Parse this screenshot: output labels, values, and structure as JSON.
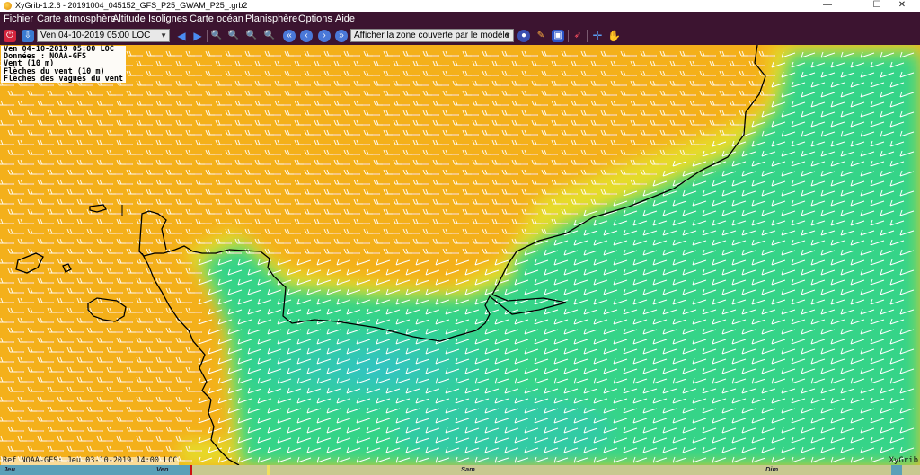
{
  "window": {
    "title": "XyGrib-1.2.6 - 20191004_045152_GFS_P25_GWAM_P25_.grb2",
    "minimize_glyph": "—",
    "maximize_glyph": "☐",
    "close_glyph": "✕"
  },
  "menubar": {
    "items": [
      "Fichier",
      "Carte atmosphère",
      "Altitude",
      "Isolignes",
      "Carte océan",
      "Planisphère",
      "Options",
      "Aide"
    ]
  },
  "toolbar": {
    "date_combo": "Ven 04-10-2019 05:00 LOC",
    "zone_combo": "Afficher la zone couverte par le modèle",
    "icons": [
      "app-icon",
      "download-icon",
      "prev-icon",
      "next-icon",
      "zoom-in-icon",
      "zoom-out-icon",
      "zoom-fit-icon",
      "zoom-all-icon",
      "time-back-fast-icon",
      "time-back-icon",
      "time-forward-icon",
      "time-forward-fast-icon",
      "globe-icon",
      "palette-icon",
      "meteogram-icon",
      "rocket-icon",
      "crosshair-icon",
      "hand-icon"
    ]
  },
  "legend": {
    "line1": "Ven 04-10-2019 05:00 LOC",
    "line2": "Données : NOAA-GFS",
    "line3": "Vent (10 m)",
    "line4": "Flèches du vent (10 m)",
    "line5": "Flèches des vagues du vent"
  },
  "footer": {
    "ref": "Ref NOAA-GFS: Jeu 03-10-2019 14:00 LOC",
    "brand": "XyGrib"
  },
  "timeline": {
    "days": [
      "Jeu",
      "Ven",
      "Sam",
      "Dim"
    ],
    "colors": {
      "past": "#5aa0b8",
      "current": "#c8c890",
      "marker": "#cc1111",
      "current_marker": "#f0e060"
    }
  },
  "colors": {
    "wind_strong": "#f4b21a",
    "wind_moderate": "#e8dc28",
    "wind_light": "#2ed68c",
    "wind_calm": "#30c8c0",
    "coastline": "#000000",
    "menubar": "#3c1430"
  }
}
